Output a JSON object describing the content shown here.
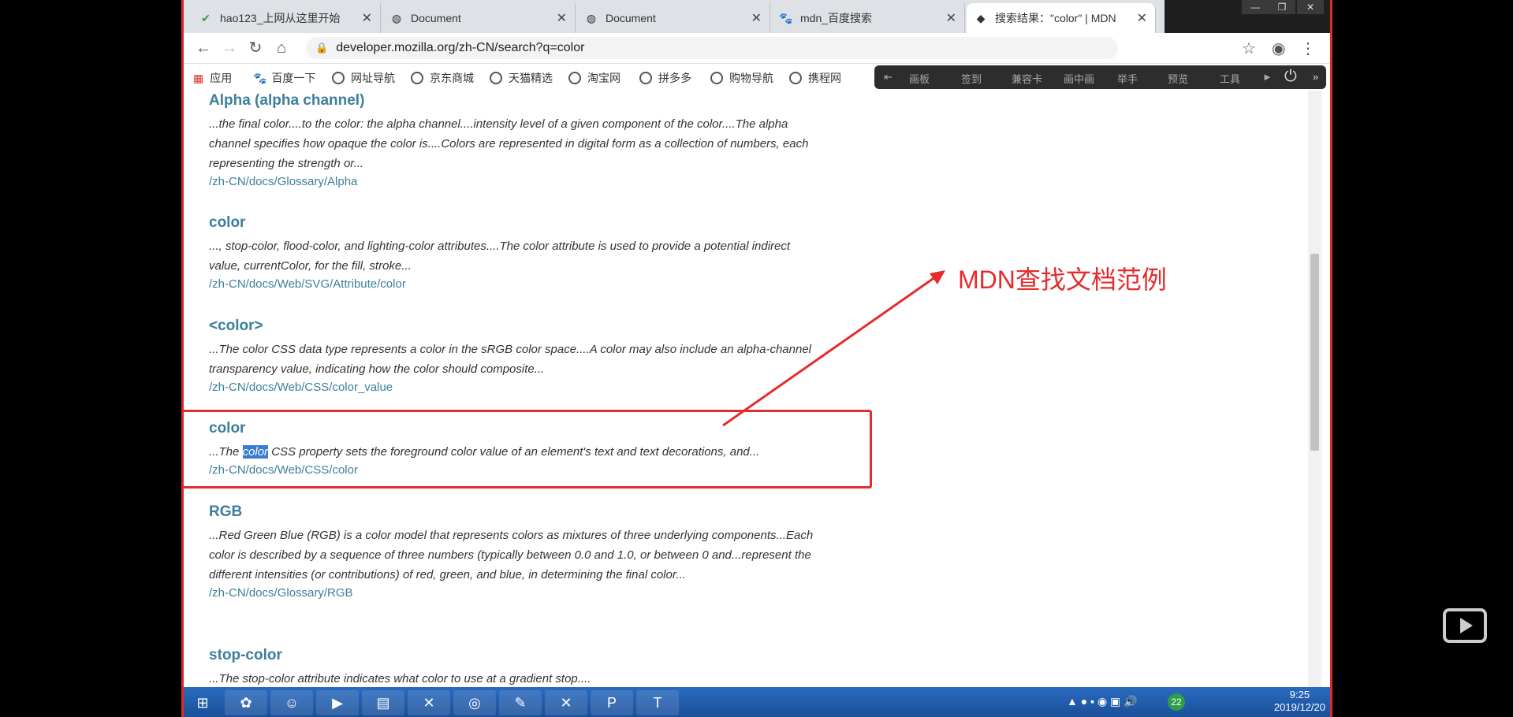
{
  "tabs": [
    {
      "title": "hao123_上网从这里开始",
      "icon": "hao123-icon"
    },
    {
      "title": "Document",
      "icon": "globe-icon"
    },
    {
      "title": "Document",
      "icon": "globe-icon"
    },
    {
      "title": "mdn_百度搜索",
      "icon": "baidu-icon"
    },
    {
      "title": "搜索结果：\"color\" | MDN",
      "icon": "mdn-icon"
    }
  ],
  "address": {
    "url": "developer.mozilla.org/zh-CN/search?q=color"
  },
  "bookmarks": [
    "应用",
    "百度一下",
    "网址导航",
    "京东商城",
    "天猫精选",
    "淘宝网",
    "拼多多",
    "购物导航",
    "携程网"
  ],
  "extension_bar": [
    "画板",
    "签到",
    "兼容卡",
    "画中画",
    "举手",
    "预览",
    "工具"
  ],
  "results": [
    {
      "title": "Alpha (alpha channel)",
      "snippet": "...the final color....to the color: the alpha channel....intensity level of a given component of the color....The alpha channel specifies how opaque the color is....Colors are represented in digital form as a collection of numbers, each representing the strength or...",
      "link": "/zh-CN/docs/Glossary/Alpha"
    },
    {
      "title": "color",
      "snippet": "..., stop-color, flood-color, and lighting-color attributes....The color attribute is used to provide a potential indirect value, currentColor, for the fill, stroke...",
      "link": "/zh-CN/docs/Web/SVG/Attribute/color"
    },
    {
      "title": "<color>",
      "snippet": "...The color CSS data type represents a color in the sRGB color space....A color may also include an alpha-channel transparency value, indicating how the color should composite...",
      "link": "/zh-CN/docs/Web/CSS/color_value"
    },
    {
      "title": "color",
      "snippet_prefix": "...The ",
      "snippet_selected": "color",
      "snippet_rest": " CSS property sets the foreground color value of an element's text and text decorations, and...",
      "link": "/zh-CN/docs/Web/CSS/color"
    },
    {
      "title": "RGB",
      "snippet": "...Red Green Blue (RGB) is a color model that represents colors as mixtures of three underlying components...Each color is described by a sequence of three numbers (typically between 0.0 and 1.0, or between 0 and...represent the different intensities (or contributions) of red, green, and blue, in determining the final color...",
      "link": "/zh-CN/docs/Glossary/RGB"
    },
    {
      "title": "stop-color",
      "snippet": "...The stop-color attribute indicates what color to use at a gradient stop...."
    }
  ],
  "annotation": {
    "text": "MDN查找文档范例",
    "color": "#e52b2b"
  },
  "taskbar": {
    "time": "9:25",
    "date": "2019/12/20",
    "badge": "22"
  }
}
